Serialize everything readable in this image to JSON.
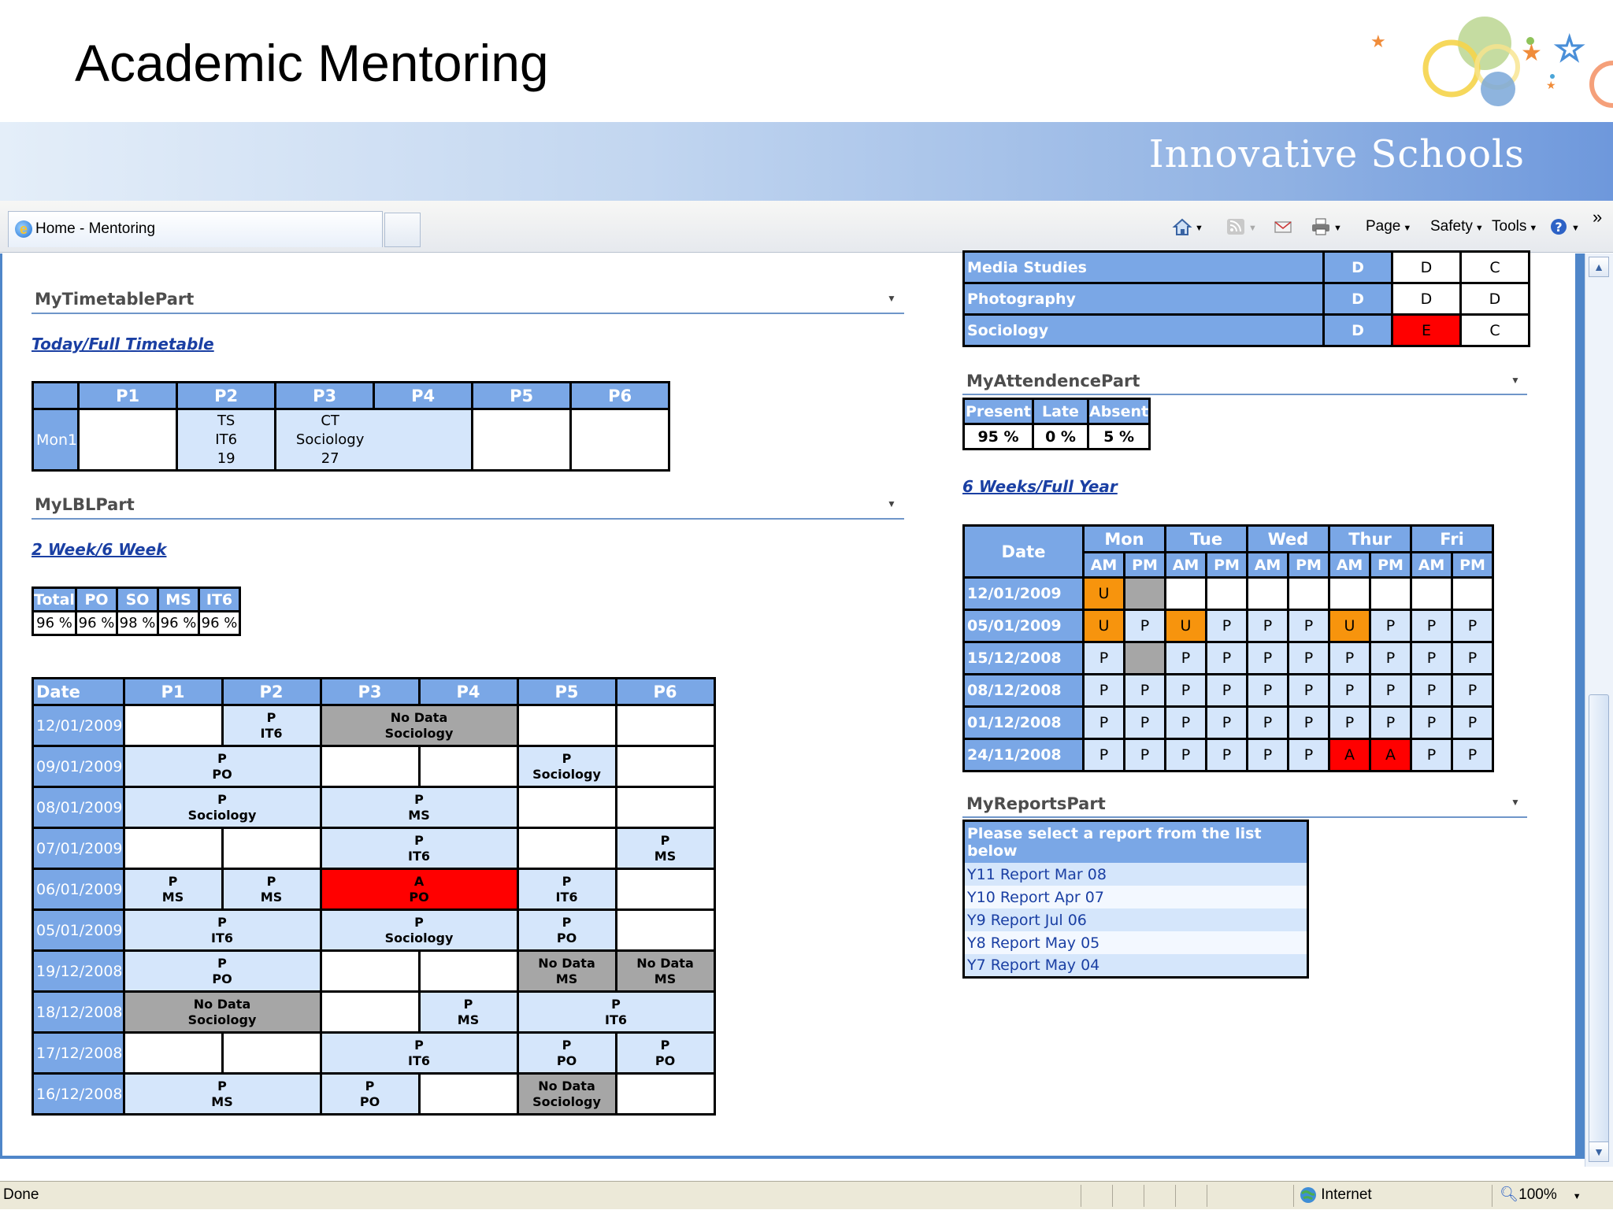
{
  "slide": {
    "title": "Academic Mentoring",
    "brand": "Innovative Schools"
  },
  "browser": {
    "tab_title": "Home - Mentoring",
    "cmd": {
      "page": "Page",
      "safety": "Safety",
      "tools": "Tools",
      "more": "»"
    },
    "status": {
      "left": "Done",
      "zone": "Internet",
      "zoom": "100%"
    }
  },
  "timetable": {
    "title": "MyTimetablePart",
    "link": "Today/Full Timetable",
    "headers": [
      "P1",
      "P2",
      "P3",
      "P4",
      "P5",
      "P6"
    ],
    "day": "Mon1",
    "p2": [
      "TS",
      "IT6",
      "19"
    ],
    "p3": [
      "CT",
      "Sociology",
      "27"
    ]
  },
  "lbl": {
    "title": "MyLBLPart",
    "link": "2 Week/6 Week",
    "summary_headers": [
      "Total",
      "PO",
      "SO",
      "MS",
      "IT6"
    ],
    "summary_values": [
      "96 %",
      "96 %",
      "98 %",
      "96 %",
      "96 %"
    ],
    "grid_headers": [
      "Date",
      "P1",
      "P2",
      "P3",
      "P4",
      "P5",
      "P6"
    ],
    "dates": [
      "12/01/2009",
      "09/01/2009",
      "08/01/2009",
      "07/01/2009",
      "06/01/2009",
      "05/01/2009",
      "19/12/2008",
      "18/12/2008",
      "17/12/2008",
      "16/12/2008"
    ],
    "cells": {
      "r0": {
        "p2": [
          "P",
          "IT6"
        ],
        "p34": [
          "No Data",
          "Sociology"
        ]
      },
      "r1": {
        "p12": [
          "P",
          "PO"
        ],
        "p5": [
          "P",
          "Sociology"
        ]
      },
      "r2": {
        "p12": [
          "P",
          "Sociology"
        ],
        "p34": [
          "P",
          "MS"
        ]
      },
      "r3": {
        "p34": [
          "P",
          "IT6"
        ],
        "p6": [
          "P",
          "MS"
        ]
      },
      "r4": {
        "p1": [
          "P",
          "MS"
        ],
        "p2": [
          "P",
          "MS"
        ],
        "p34": [
          "A",
          "PO"
        ],
        "p5": [
          "P",
          "IT6"
        ]
      },
      "r5": {
        "p12": [
          "P",
          "IT6"
        ],
        "p34": [
          "P",
          "Sociology"
        ],
        "p5": [
          "P",
          "PO"
        ]
      },
      "r6": {
        "p12": [
          "P",
          "PO"
        ],
        "p5": [
          "No Data",
          "MS"
        ],
        "p6": [
          "No Data",
          "MS"
        ]
      },
      "r7": {
        "p12": [
          "No Data",
          "Sociology"
        ],
        "p4": [
          "P",
          "MS"
        ],
        "p56": [
          "P",
          "IT6"
        ]
      },
      "r8": {
        "p34": [
          "P",
          "IT6"
        ],
        "p5": [
          "P",
          "PO"
        ],
        "p6": [
          "P",
          "PO"
        ]
      },
      "r9": {
        "p12": [
          "P",
          "MS"
        ],
        "p3": [
          "P",
          "PO"
        ],
        "p5": [
          "No Data",
          "Sociology"
        ]
      }
    }
  },
  "grades": {
    "rows": [
      {
        "subject": "Media Studies",
        "target": "D",
        "current": "D",
        "predicted": "C"
      },
      {
        "subject": "Photography",
        "target": "D",
        "current": "D",
        "predicted": "D"
      },
      {
        "subject": "Sociology",
        "target": "D",
        "current": "E",
        "predicted": "C"
      }
    ]
  },
  "attendance": {
    "title": "MyAttendencePart",
    "headers": [
      "Present",
      "Late",
      "Absent"
    ],
    "values": [
      "95 %",
      "0 %",
      "5 %"
    ],
    "link": "6 Weeks/Full Year",
    "grid_date": "Date",
    "days": [
      "Mon",
      "Tue",
      "Wed",
      "Thur",
      "Fri"
    ],
    "halves": [
      "AM",
      "PM"
    ],
    "rows": [
      {
        "date": "12/01/2009",
        "marks": [
          "U",
          "",
          "",
          "",
          "",
          "",
          "",
          "",
          "",
          ""
        ],
        "colors": [
          "or",
          "gr",
          "wt",
          "wt",
          "wt",
          "wt",
          "wt",
          "wt",
          "wt",
          "wt"
        ]
      },
      {
        "date": "05/01/2009",
        "marks": [
          "U",
          "P",
          "U",
          "P",
          "P",
          "P",
          "U",
          "P",
          "P",
          "P"
        ],
        "colors": [
          "or",
          "lb",
          "or",
          "lb",
          "lb",
          "lb",
          "or",
          "lb",
          "lb",
          "lb"
        ]
      },
      {
        "date": "15/12/2008",
        "marks": [
          "P",
          "",
          "P",
          "P",
          "P",
          "P",
          "P",
          "P",
          "P",
          "P"
        ],
        "colors": [
          "lb",
          "gr",
          "lb",
          "lb",
          "lb",
          "lb",
          "lb",
          "lb",
          "lb",
          "lb"
        ]
      },
      {
        "date": "08/12/2008",
        "marks": [
          "P",
          "P",
          "P",
          "P",
          "P",
          "P",
          "P",
          "P",
          "P",
          "P"
        ],
        "colors": [
          "lb",
          "lb",
          "lb",
          "lb",
          "lb",
          "lb",
          "lb",
          "lb",
          "lb",
          "lb"
        ]
      },
      {
        "date": "01/12/2008",
        "marks": [
          "P",
          "P",
          "P",
          "P",
          "P",
          "P",
          "P",
          "P",
          "P",
          "P"
        ],
        "colors": [
          "lb",
          "lb",
          "lb",
          "lb",
          "lb",
          "lb",
          "lb",
          "lb",
          "lb",
          "lb"
        ]
      },
      {
        "date": "24/11/2008",
        "marks": [
          "P",
          "P",
          "P",
          "P",
          "P",
          "P",
          "A",
          "A",
          "P",
          "P"
        ],
        "colors": [
          "lb",
          "lb",
          "lb",
          "lb",
          "lb",
          "lb",
          "rd",
          "rd",
          "lb",
          "lb"
        ]
      }
    ]
  },
  "reports": {
    "title": "MyReportsPart",
    "header": "Please select a report from the list below",
    "items": [
      "Y11 Report Mar 08",
      "Y10 Report Apr 07",
      "Y9 Report Jul 06",
      "Y8 Report May 05",
      "Y7 Report May 04"
    ]
  },
  "colors": {
    "header_blue": "#7aa7e6",
    "cell_blue": "#d5e6fb",
    "absent_red": "#ff0000",
    "unexplained_orange": "#f7940d",
    "nodata_grey": "#a6a6a6"
  }
}
